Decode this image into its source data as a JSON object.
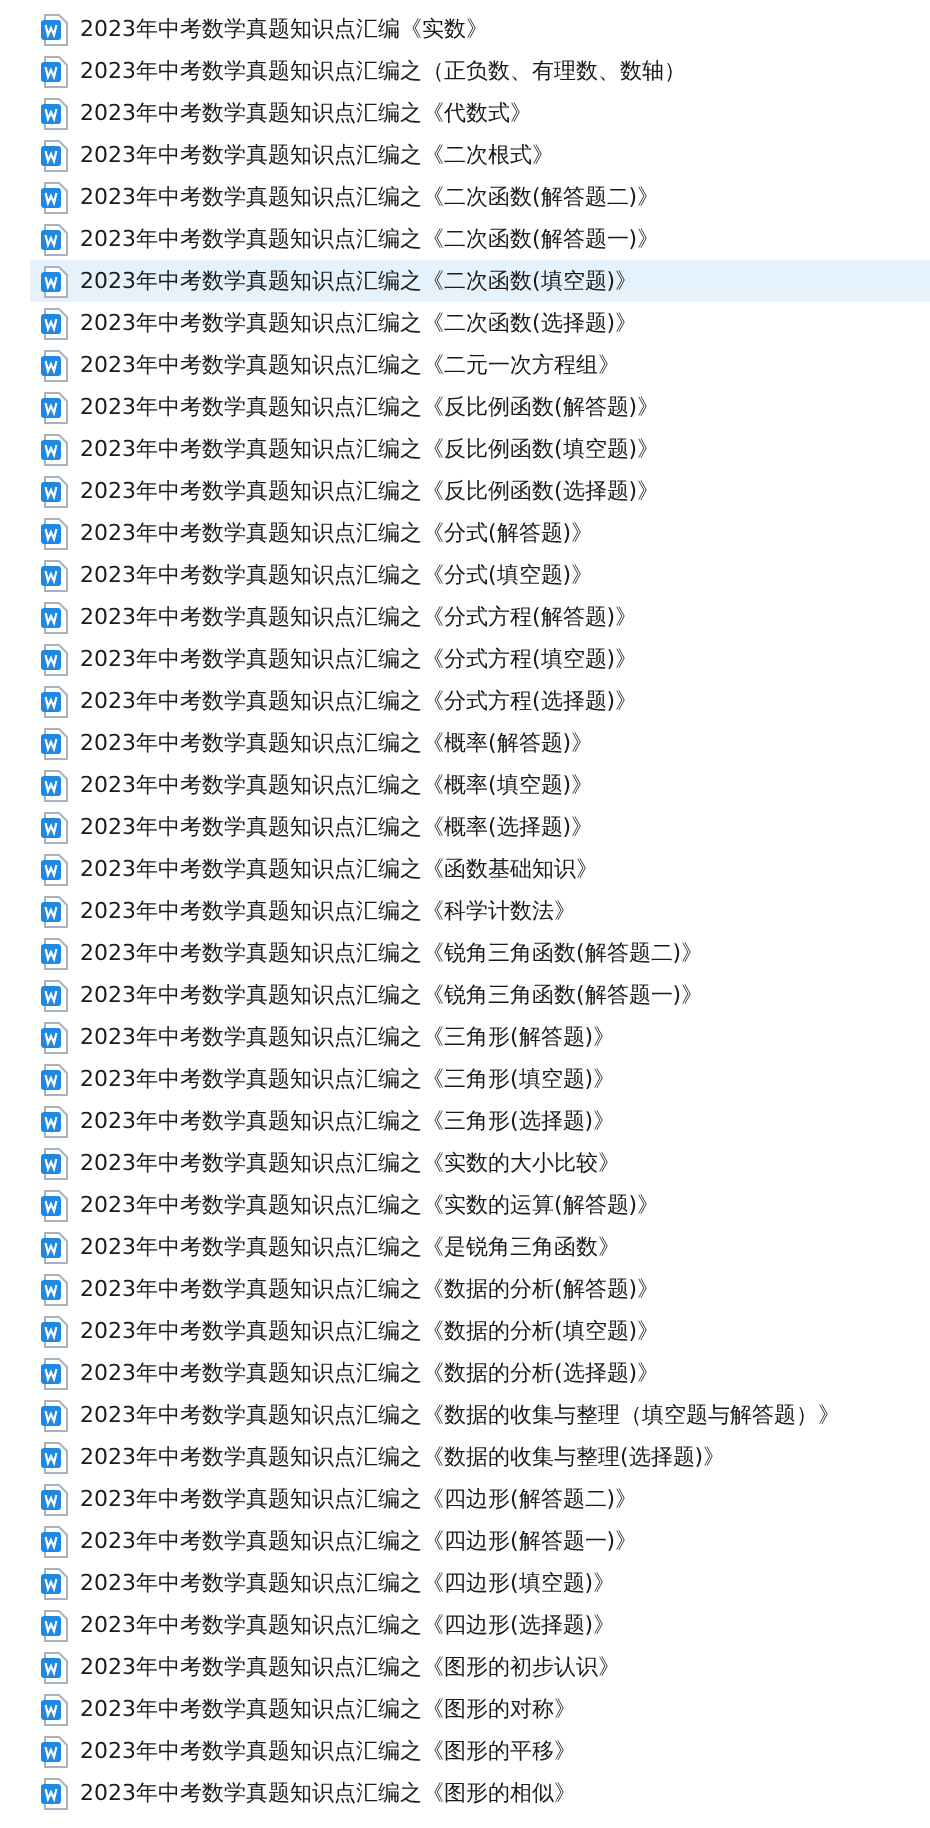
{
  "files": [
    {
      "name": "2023年中考数学真题知识点汇编《实数》",
      "selected": false
    },
    {
      "name": "2023年中考数学真题知识点汇编之（正负数、有理数、数轴）",
      "selected": false
    },
    {
      "name": "2023年中考数学真题知识点汇编之《代数式》",
      "selected": false
    },
    {
      "name": "2023年中考数学真题知识点汇编之《二次根式》",
      "selected": false
    },
    {
      "name": "2023年中考数学真题知识点汇编之《二次函数(解答题二)》",
      "selected": false
    },
    {
      "name": "2023年中考数学真题知识点汇编之《二次函数(解答题一)》",
      "selected": false
    },
    {
      "name": "2023年中考数学真题知识点汇编之《二次函数(填空题)》",
      "selected": true
    },
    {
      "name": "2023年中考数学真题知识点汇编之《二次函数(选择题)》",
      "selected": false
    },
    {
      "name": "2023年中考数学真题知识点汇编之《二元一次方程组》",
      "selected": false
    },
    {
      "name": "2023年中考数学真题知识点汇编之《反比例函数(解答题)》",
      "selected": false
    },
    {
      "name": "2023年中考数学真题知识点汇编之《反比例函数(填空题)》",
      "selected": false
    },
    {
      "name": "2023年中考数学真题知识点汇编之《反比例函数(选择题)》",
      "selected": false
    },
    {
      "name": "2023年中考数学真题知识点汇编之《分式(解答题)》",
      "selected": false
    },
    {
      "name": "2023年中考数学真题知识点汇编之《分式(填空题)》",
      "selected": false
    },
    {
      "name": "2023年中考数学真题知识点汇编之《分式方程(解答题)》",
      "selected": false
    },
    {
      "name": "2023年中考数学真题知识点汇编之《分式方程(填空题)》",
      "selected": false
    },
    {
      "name": "2023年中考数学真题知识点汇编之《分式方程(选择题)》",
      "selected": false
    },
    {
      "name": "2023年中考数学真题知识点汇编之《概率(解答题)》",
      "selected": false
    },
    {
      "name": "2023年中考数学真题知识点汇编之《概率(填空题)》",
      "selected": false
    },
    {
      "name": "2023年中考数学真题知识点汇编之《概率(选择题)》",
      "selected": false
    },
    {
      "name": "2023年中考数学真题知识点汇编之《函数基础知识》",
      "selected": false
    },
    {
      "name": "2023年中考数学真题知识点汇编之《科学计数法》",
      "selected": false
    },
    {
      "name": "2023年中考数学真题知识点汇编之《锐角三角函数(解答题二)》",
      "selected": false
    },
    {
      "name": "2023年中考数学真题知识点汇编之《锐角三角函数(解答题一)》",
      "selected": false
    },
    {
      "name": "2023年中考数学真题知识点汇编之《三角形(解答题)》",
      "selected": false
    },
    {
      "name": "2023年中考数学真题知识点汇编之《三角形(填空题)》",
      "selected": false
    },
    {
      "name": "2023年中考数学真题知识点汇编之《三角形(选择题)》",
      "selected": false
    },
    {
      "name": "2023年中考数学真题知识点汇编之《实数的大小比较》",
      "selected": false
    },
    {
      "name": "2023年中考数学真题知识点汇编之《实数的运算(解答题)》",
      "selected": false
    },
    {
      "name": "2023年中考数学真题知识点汇编之《是锐角三角函数》",
      "selected": false
    },
    {
      "name": "2023年中考数学真题知识点汇编之《数据的分析(解答题)》",
      "selected": false
    },
    {
      "name": "2023年中考数学真题知识点汇编之《数据的分析(填空题)》",
      "selected": false
    },
    {
      "name": "2023年中考数学真题知识点汇编之《数据的分析(选择题)》",
      "selected": false
    },
    {
      "name": "2023年中考数学真题知识点汇编之《数据的收集与整理（填空题与解答题）》",
      "selected": false
    },
    {
      "name": "2023年中考数学真题知识点汇编之《数据的收集与整理(选择题)》",
      "selected": false
    },
    {
      "name": "2023年中考数学真题知识点汇编之《四边形(解答题二)》",
      "selected": false
    },
    {
      "name": "2023年中考数学真题知识点汇编之《四边形(解答题一)》",
      "selected": false
    },
    {
      "name": "2023年中考数学真题知识点汇编之《四边形(填空题)》",
      "selected": false
    },
    {
      "name": "2023年中考数学真题知识点汇编之《四边形(选择题)》",
      "selected": false
    },
    {
      "name": "2023年中考数学真题知识点汇编之《图形的初步认识》",
      "selected": false
    },
    {
      "name": "2023年中考数学真题知识点汇编之《图形的对称》",
      "selected": false
    },
    {
      "name": "2023年中考数学真题知识点汇编之《图形的平移》",
      "selected": false
    },
    {
      "name": "2023年中考数学真题知识点汇编之《图形的相似》",
      "selected": false
    }
  ]
}
